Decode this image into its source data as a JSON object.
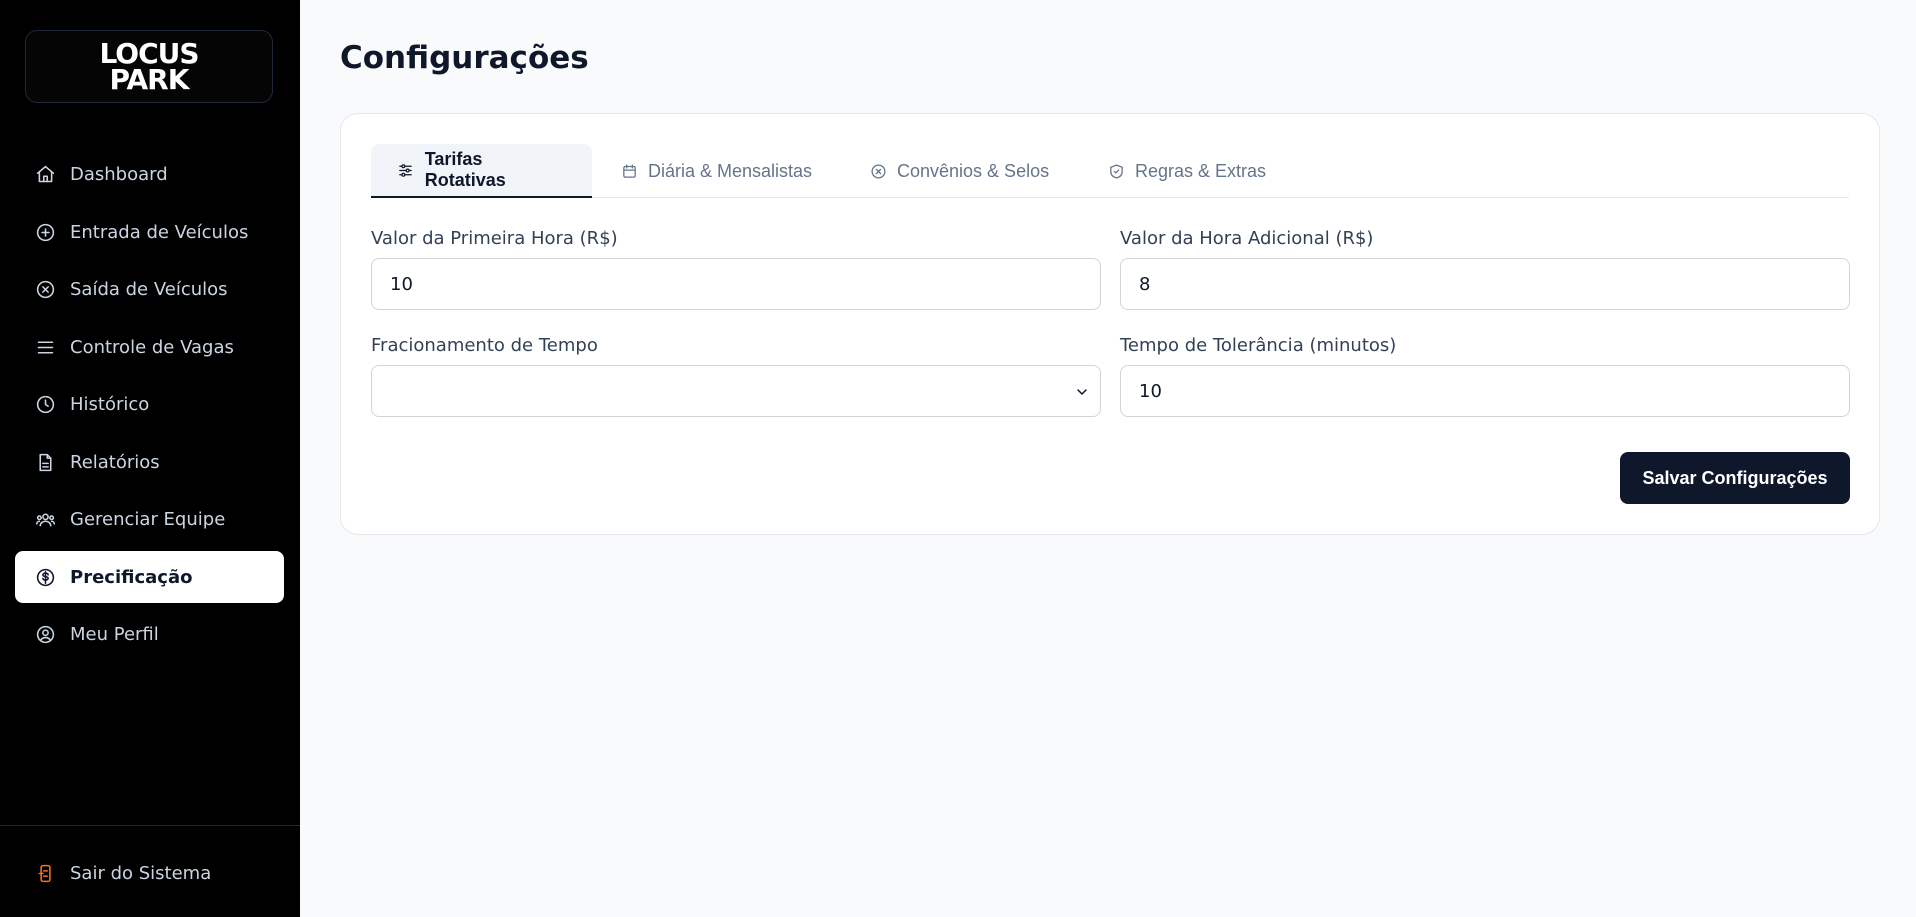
{
  "brand": {
    "logo_line1": "LOCUS",
    "logo_line2": "PARK"
  },
  "sidebar": {
    "items": [
      {
        "label": "Dashboard",
        "icon": "home-icon"
      },
      {
        "label": "Entrada de Veículos",
        "icon": "plus-circle-icon"
      },
      {
        "label": "Saída de Veículos",
        "icon": "x-circle-icon"
      },
      {
        "label": "Controle de Vagas",
        "icon": "menu-icon"
      },
      {
        "label": "Histórico",
        "icon": "clock-icon"
      },
      {
        "label": "Relatórios",
        "icon": "file-text-icon"
      },
      {
        "label": "Gerenciar Equipe",
        "icon": "users-icon"
      },
      {
        "label": "Precificação",
        "icon": "dollar-circle-icon",
        "active": true
      },
      {
        "label": "Meu Perfil",
        "icon": "user-circle-icon"
      }
    ],
    "logout_label": "Sair do Sistema"
  },
  "page": {
    "title": "Configurações"
  },
  "tabs": [
    {
      "label": "Tarifas Rotativas",
      "icon": "sliders-icon",
      "active": true
    },
    {
      "label": "Diária & Mensalistas",
      "icon": "calendar-icon"
    },
    {
      "label": "Convênios & Selos",
      "icon": "x-circle-icon"
    },
    {
      "label": "Regras & Extras",
      "icon": "shield-check-icon"
    }
  ],
  "form": {
    "first_hour_label": "Valor da Primeira Hora (R$)",
    "first_hour_value": "10",
    "additional_hour_label": "Valor da Hora Adicional (R$)",
    "additional_hour_value": "8",
    "fraction_label": "Fracionamento de Tempo",
    "fraction_value": "",
    "tolerance_label": "Tempo de Tolerância (minutos)",
    "tolerance_value": "10",
    "save_label": "Salvar Configurações"
  },
  "colors": {
    "sidebar_bg": "#000000",
    "page_bg": "#f8fafc",
    "primary": "#0f172a",
    "logout_accent": "#f97316"
  }
}
